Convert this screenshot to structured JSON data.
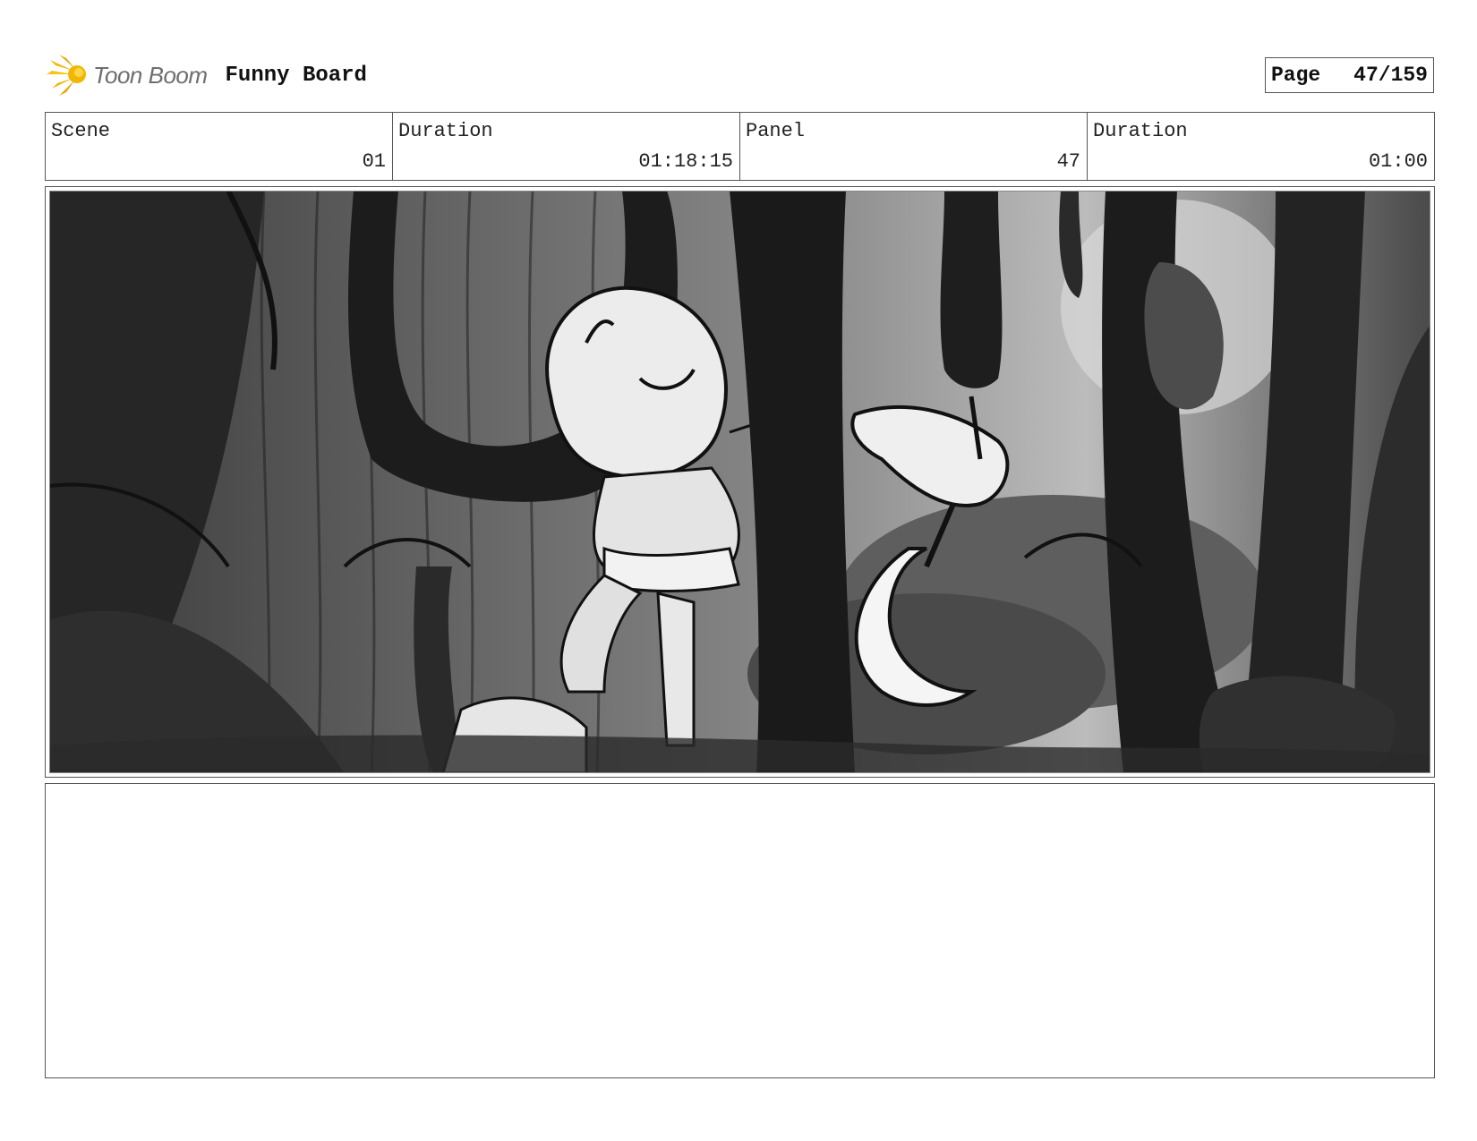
{
  "header": {
    "logo_text": "Toon Boom",
    "logo_icon": "starburst-logo-icon",
    "board_title": "Funny Board",
    "page_label": "Page",
    "page_value": "47/159"
  },
  "info": [
    {
      "label": "Scene",
      "value": "01"
    },
    {
      "label": "Duration",
      "value": "01:18:15"
    },
    {
      "label": "Panel",
      "value": "47"
    },
    {
      "label": "Duration",
      "value": "01:00"
    }
  ],
  "panel": {
    "image": "storyboard-panel-sketch",
    "colors": {
      "dark": "#1e1e1e",
      "mid": "#6a6a6a",
      "light": "#ededed",
      "accent": "#f2b705"
    }
  },
  "notes": {
    "text": ""
  }
}
